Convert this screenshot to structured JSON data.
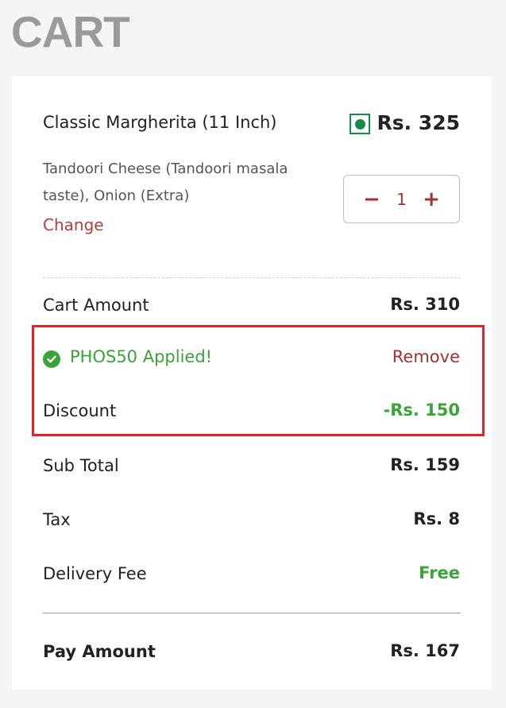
{
  "page": {
    "title": "CART"
  },
  "item": {
    "name": "Classic Margherita (11 Inch)",
    "price": "Rs. 325",
    "description": "Tandoori Cheese (Tandoori masala taste), Onion (Extra)",
    "change_label": "Change",
    "quantity": "1",
    "minus_symbol": "−",
    "plus_symbol": "+",
    "veg_icon": "veg-indicator-icon"
  },
  "summary": {
    "cart_amount_label": "Cart Amount",
    "cart_amount_value": "Rs. 310",
    "promo_text": "PHOS50 Applied!",
    "promo_remove_label": "Remove",
    "discount_label": "Discount",
    "discount_value": "-Rs. 150",
    "subtotal_label": "Sub Total",
    "subtotal_value": "Rs. 159",
    "tax_label": "Tax",
    "tax_value": "Rs. 8",
    "delivery_label": "Delivery Fee",
    "delivery_value": "Free",
    "pay_label": "Pay Amount",
    "pay_value": "Rs. 167"
  },
  "colors": {
    "accent_red": "#a3322c",
    "success_green": "#3aa33a",
    "highlight_red": "#e0242f",
    "veg_green": "#178a4e"
  }
}
